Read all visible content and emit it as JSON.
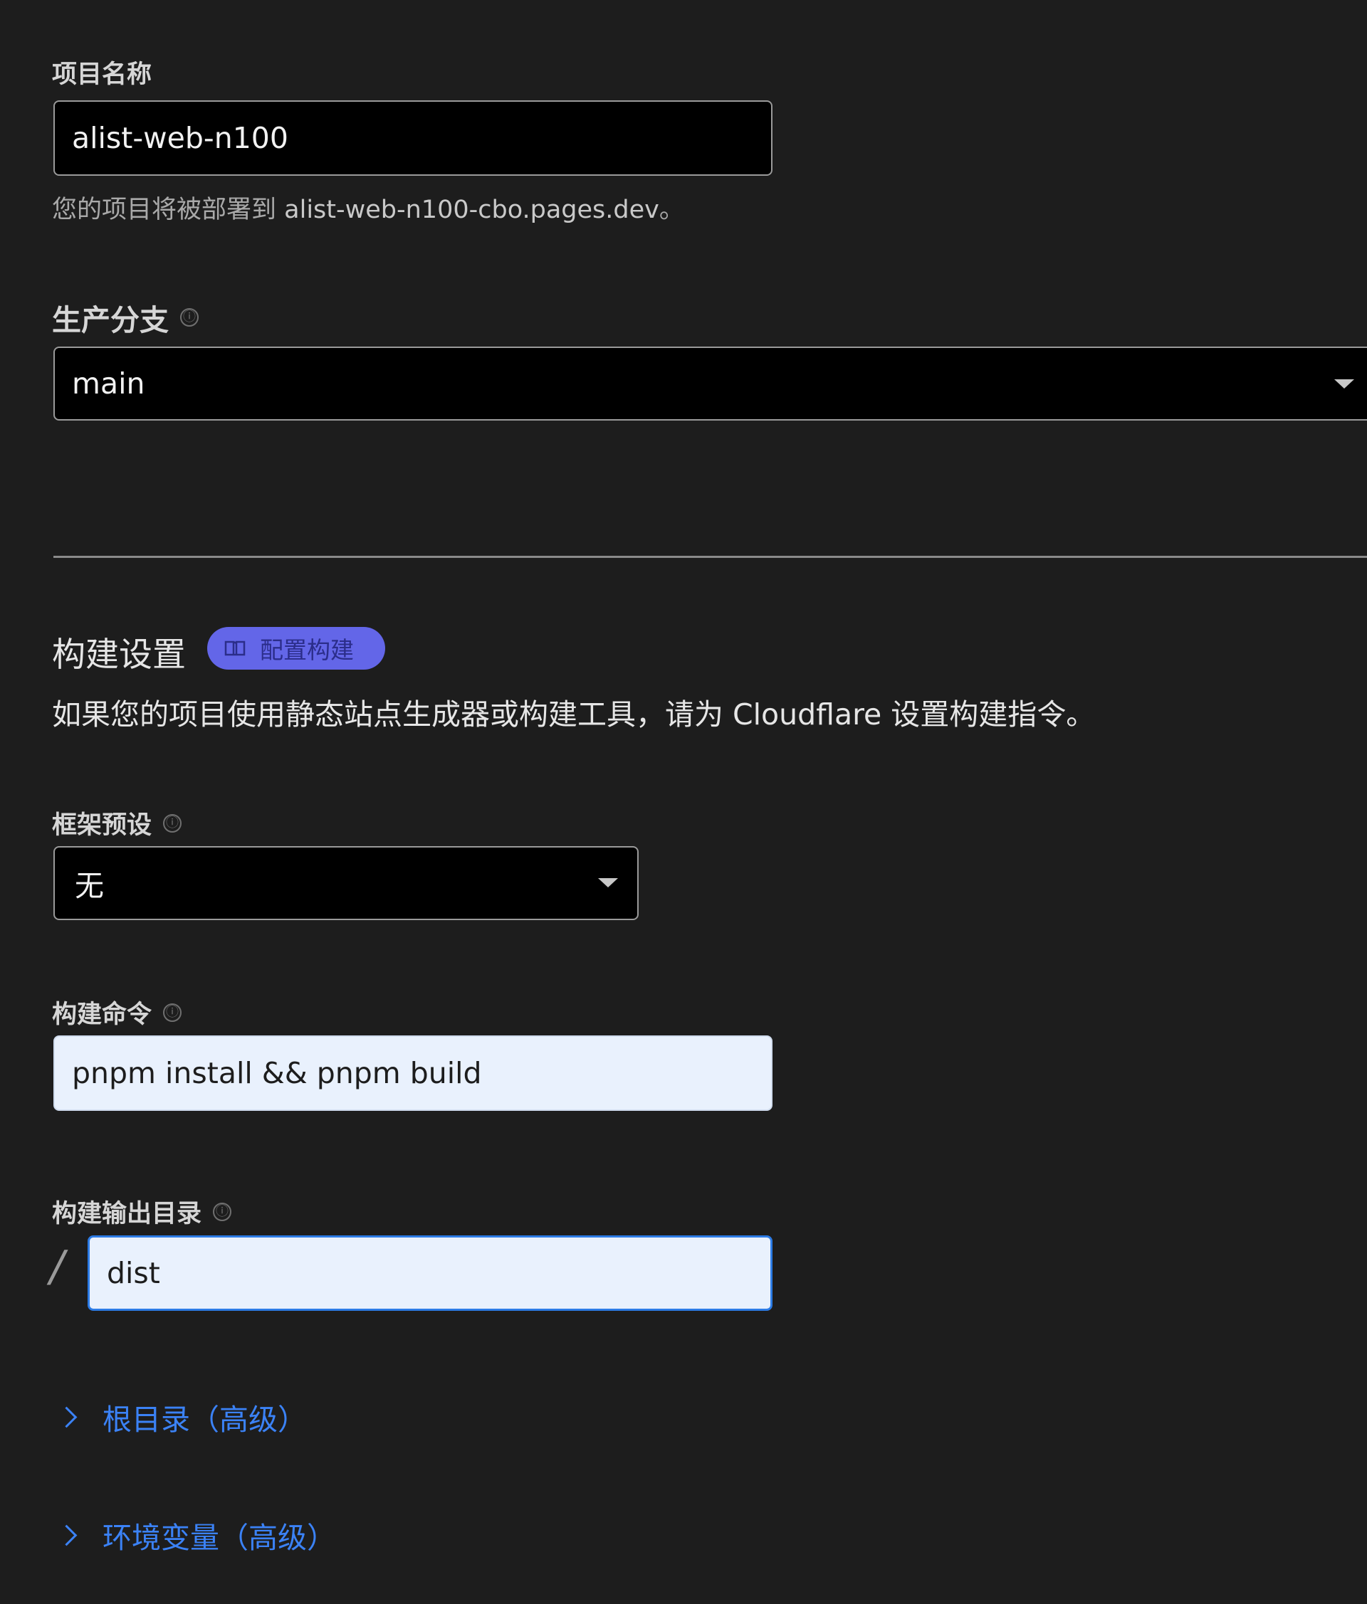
{
  "project_name": {
    "label": "项目名称",
    "value": "alist-web-n100",
    "hint_prefix": "您的项目将被部署到 ",
    "hint_domain": "alist-web-n100-cbo.pages.dev",
    "hint_suffix": "。"
  },
  "production_branch": {
    "label": "生产分支",
    "info_icon": "ⓘ",
    "value": "main"
  },
  "build_settings": {
    "title": "构建设置",
    "badge_label": "配置构建",
    "description": "如果您的项目使用静态站点生成器或构建工具，请为 Cloudflare 设置构建指令。"
  },
  "framework_preset": {
    "label": "框架预设",
    "info_icon": "ⓘ",
    "value": "无"
  },
  "build_command": {
    "label": "构建命令",
    "info_icon": "ⓘ",
    "value": "pnpm install && pnpm build"
  },
  "build_output": {
    "label": "构建输出目录",
    "info_icon": "ⓘ",
    "prefix": "/",
    "value": "dist"
  },
  "advanced": {
    "root_directory": "根目录（高级）",
    "env_vars": "环境变量（高级）"
  },
  "colors": {
    "background": "#1d1d1d",
    "accent_badge": "#6366e8",
    "link": "#3b82f6",
    "focus_border": "#2c7be5"
  }
}
